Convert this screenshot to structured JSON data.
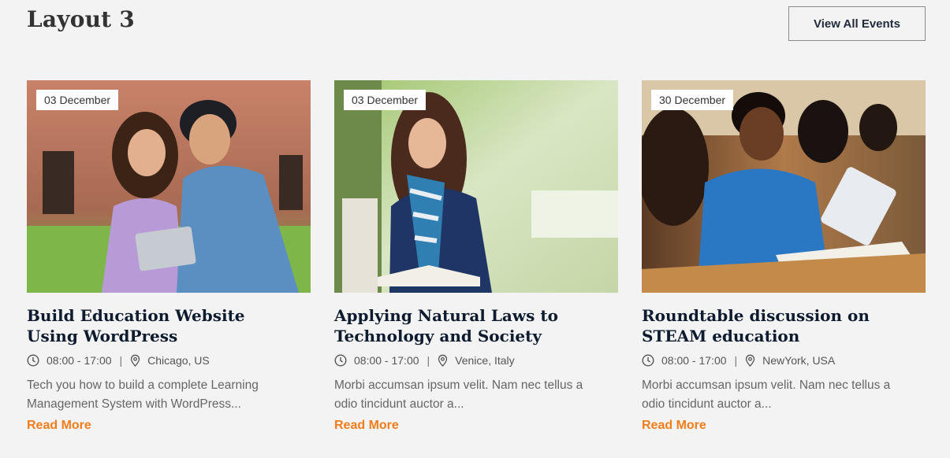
{
  "header": {
    "title": "Layout 3",
    "view_all_label": "View All Events"
  },
  "colors": {
    "accent": "#f07d1a",
    "title": "#0d1b2e",
    "background": "#f3f3f3"
  },
  "events": [
    {
      "date": "03 December",
      "title": "Build Education Website Using WordPress",
      "time": "08:00 - 17:00",
      "location": "Chicago, US",
      "description": "Tech you how to build a complete Learning Management System with WordPress...",
      "read_more": "Read More"
    },
    {
      "date": "03 December",
      "title": "Applying Natural Laws to Technology and Society",
      "time": "08:00 - 17:00",
      "location": "Venice, Italy",
      "description": "Morbi accumsan ipsum velit. Nam nec tellus a odio tincidunt auctor a...",
      "read_more": "Read More"
    },
    {
      "date": "30 December",
      "title": "Roundtable discussion on STEAM education",
      "time": "08:00 - 17:00",
      "location": "NewYork, USA",
      "description": "Morbi accumsan ipsum velit. Nam nec tellus a odio tincidunt auctor a...",
      "read_more": "Read More"
    }
  ],
  "icons": {
    "time": "clock-icon",
    "location": "map-pin-icon"
  }
}
